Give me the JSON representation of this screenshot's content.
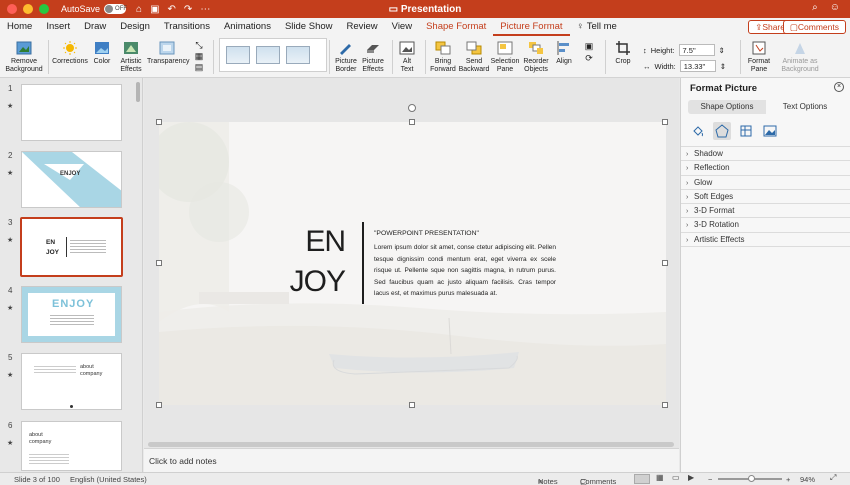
{
  "titlebar": {
    "autosave_label": "AutoSave",
    "autosave_state": "OFF",
    "doc_title": "Presentation"
  },
  "menu": {
    "tabs": [
      "Home",
      "Insert",
      "Draw",
      "Design",
      "Transitions",
      "Animations",
      "Slide Show",
      "Review",
      "View"
    ],
    "context_tabs": [
      "Shape Format",
      "Picture Format"
    ],
    "active_tab": "Picture Format",
    "tell_me": "Tell me",
    "share": "Share",
    "comments": "Comments"
  },
  "ribbon": {
    "remove_background": "Remove\nBackground",
    "corrections": "Corrections",
    "color": "Color",
    "artistic_effects": "Artistic\nEffects",
    "transparency": "Transparency",
    "picture_border": "Picture\nBorder",
    "picture_effects": "Picture\nEffects",
    "alt_text": "Alt\nText",
    "bring_forward": "Bring\nForward",
    "send_backward": "Send\nBackward",
    "selection_pane": "Selection\nPane",
    "reorder_objects": "Reorder\nObjects",
    "align": "Align",
    "crop": "Crop",
    "height_label": "Height:",
    "height_value": "7.5\"",
    "width_label": "Width:",
    "width_value": "13.33\"",
    "format_pane": "Format\nPane",
    "animate_as_background": "Animate as\nBackground"
  },
  "thumbnails": [
    {
      "num": "1",
      "content": ""
    },
    {
      "num": "2",
      "content": "ENJOY"
    },
    {
      "num": "3",
      "content": "EN JOY"
    },
    {
      "num": "4",
      "content": "ENJOY"
    },
    {
      "num": "5",
      "content": "about company"
    },
    {
      "num": "6",
      "content": "about company"
    }
  ],
  "slide": {
    "title_line1": "EN",
    "title_line2": "JOY",
    "subtitle": "\"POWERPOINT PRESENTATION\"",
    "body": "Lorem ipsum dolor sit amet, conse ctetur adipiscing elit. Pellen tesque dignissim condi mentum erat, eget viverra ex scele risque ut. Pellente sque non sagittis magna, in rutrum purus. Sed faucibus quam ac justo aliquam facilisis. Cras tempor lacus est, et maximus purus malesuada at."
  },
  "notes_placeholder": "Click to add notes",
  "format_pane": {
    "title": "Format Picture",
    "tab_shape": "Shape Options",
    "tab_text": "Text Options",
    "sections": [
      "Shadow",
      "Reflection",
      "Glow",
      "Soft Edges",
      "3-D Format",
      "3-D Rotation",
      "Artistic Effects"
    ]
  },
  "status": {
    "slide_info": "Slide 3 of 100",
    "language": "English (United States)",
    "notes": "Notes",
    "comments": "Comments",
    "zoom": "94%"
  },
  "colors": {
    "accent": "#c43e1c",
    "thumb_blue": "#a9d6e5"
  }
}
